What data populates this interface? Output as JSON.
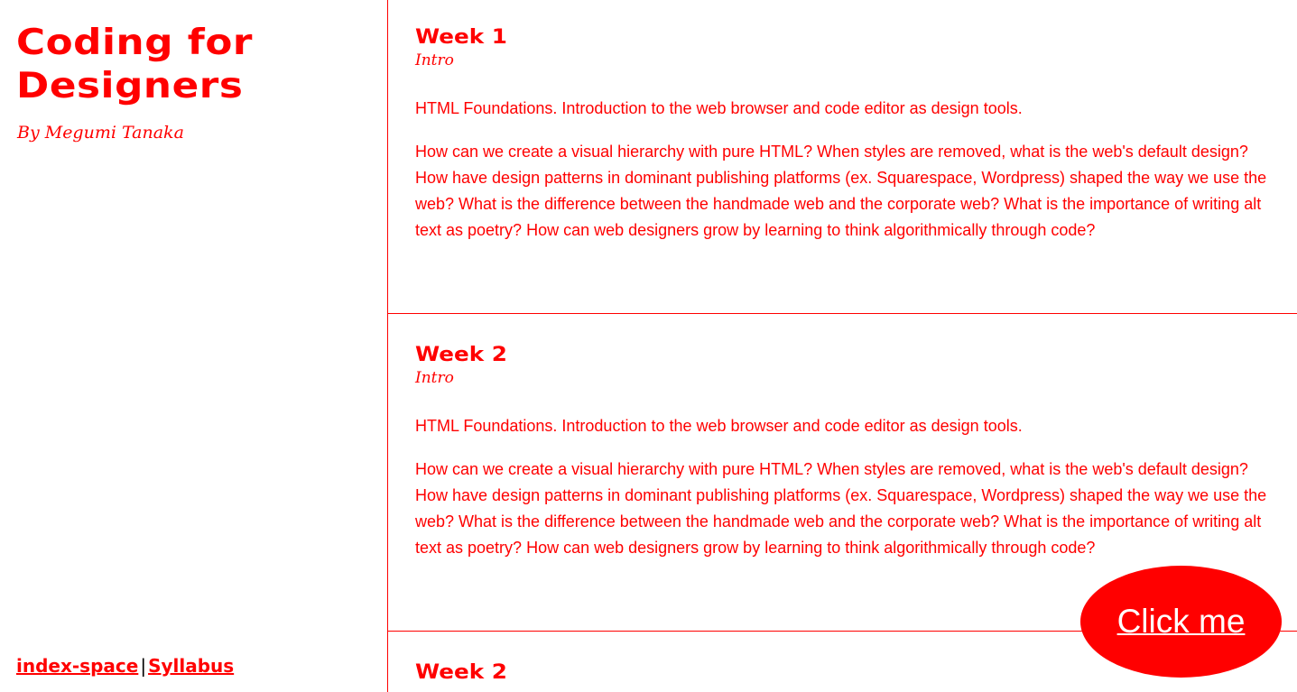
{
  "sidebar": {
    "title": "Coding for Designers",
    "byline": "By Megumi Tanaka",
    "footer": {
      "link1": "index-space",
      "separator": "|",
      "link2": "Syllabus"
    }
  },
  "weeks": [
    {
      "title": "Week 1",
      "subtitle": "Intro",
      "summary": "HTML Foundations. Introduction to the web browser and code editor as design tools.",
      "questions": "How can we create a visual hierarchy with pure HTML? When styles are removed, what is the web's default design? How have design patterns in dominant publishing platforms (ex. Squarespace, Wordpress) shaped the way we use the web? What is the difference between the handmade web and the corporate web? What is the importance of writing alt text as poetry? How can web designers grow by learning to think algorithmically through code?"
    },
    {
      "title": "Week 2",
      "subtitle": "Intro",
      "summary": "HTML Foundations. Introduction to the web browser and code editor as design tools.",
      "questions": "How can we create a visual hierarchy with pure HTML? When styles are removed, what is the web's default design? How have design patterns in dominant publishing platforms (ex. Squarespace, Wordpress) shaped the way we use the web? What is the difference between the handmade web and the corporate web? What is the importance of writing alt text as poetry? How can web designers grow by learning to think algorithmically through code?"
    },
    {
      "title": "Week 2"
    }
  ],
  "cta": {
    "label": "Click me"
  },
  "colors": {
    "accent": "#ff0000",
    "background": "#ffffff"
  }
}
